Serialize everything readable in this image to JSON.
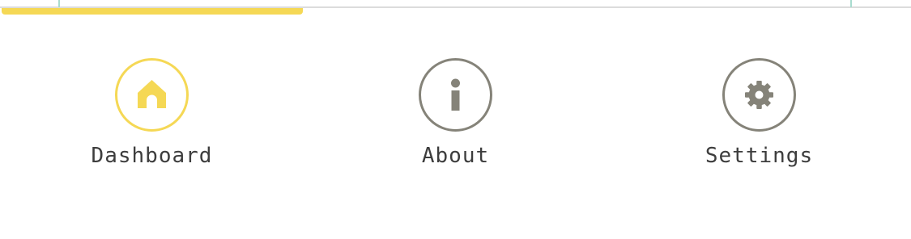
{
  "colors": {
    "active": "#f5d855",
    "inactive": "#858379",
    "divider": "#dcdcdc",
    "tick": "#a9dccf",
    "label": "#3d3d3d"
  },
  "tabs": [
    {
      "label": "Dashboard",
      "icon": "home-icon",
      "active": true
    },
    {
      "label": "About",
      "icon": "info-icon",
      "active": false
    },
    {
      "label": "Settings",
      "icon": "gear-icon",
      "active": false
    }
  ]
}
